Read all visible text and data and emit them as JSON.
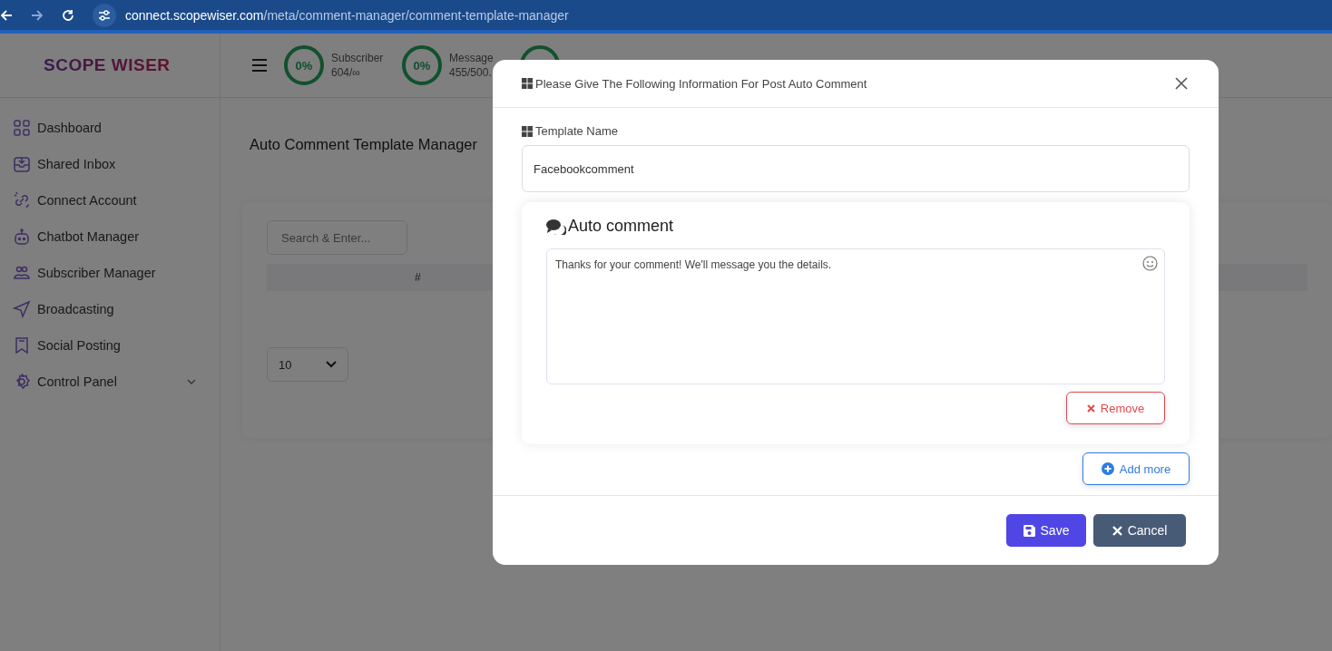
{
  "browser": {
    "url_domain": "connect.scopewiser.com",
    "url_path": "/meta/comment-manager/comment-template-manager"
  },
  "logo": "SCOPE WISER",
  "stats": [
    {
      "percent": "0%",
      "label": "Subscriber",
      "value": "604/∞"
    },
    {
      "percent": "0%",
      "label": "Message",
      "value": "455/500."
    }
  ],
  "sidebar": {
    "items": [
      {
        "label": "Dashboard",
        "expandable": false
      },
      {
        "label": "Shared Inbox",
        "expandable": false
      },
      {
        "label": "Connect Account",
        "expandable": false
      },
      {
        "label": "Chatbot Manager",
        "expandable": false
      },
      {
        "label": "Subscriber Manager",
        "expandable": false
      },
      {
        "label": "Broadcasting",
        "expandable": false
      },
      {
        "label": "Social Posting",
        "expandable": false
      },
      {
        "label": "Control Panel",
        "expandable": true
      }
    ]
  },
  "page": {
    "title": "Auto Comment Template Manager",
    "search": {
      "placeholder": "Search & Enter..."
    },
    "table": {
      "columns": [
        "#"
      ]
    },
    "page_size": "10"
  },
  "modal": {
    "title": "Please Give The Following Information For Post Auto Comment",
    "template_name": {
      "label": "Template Name",
      "value": "Facebookcomment"
    },
    "comments": [
      {
        "heading": "Auto comment",
        "value": "Thanks for your comment! We'll message you the details.",
        "remove": "Remove"
      }
    ],
    "add_more": "Add more",
    "save": "Save",
    "cancel": "Cancel"
  }
}
